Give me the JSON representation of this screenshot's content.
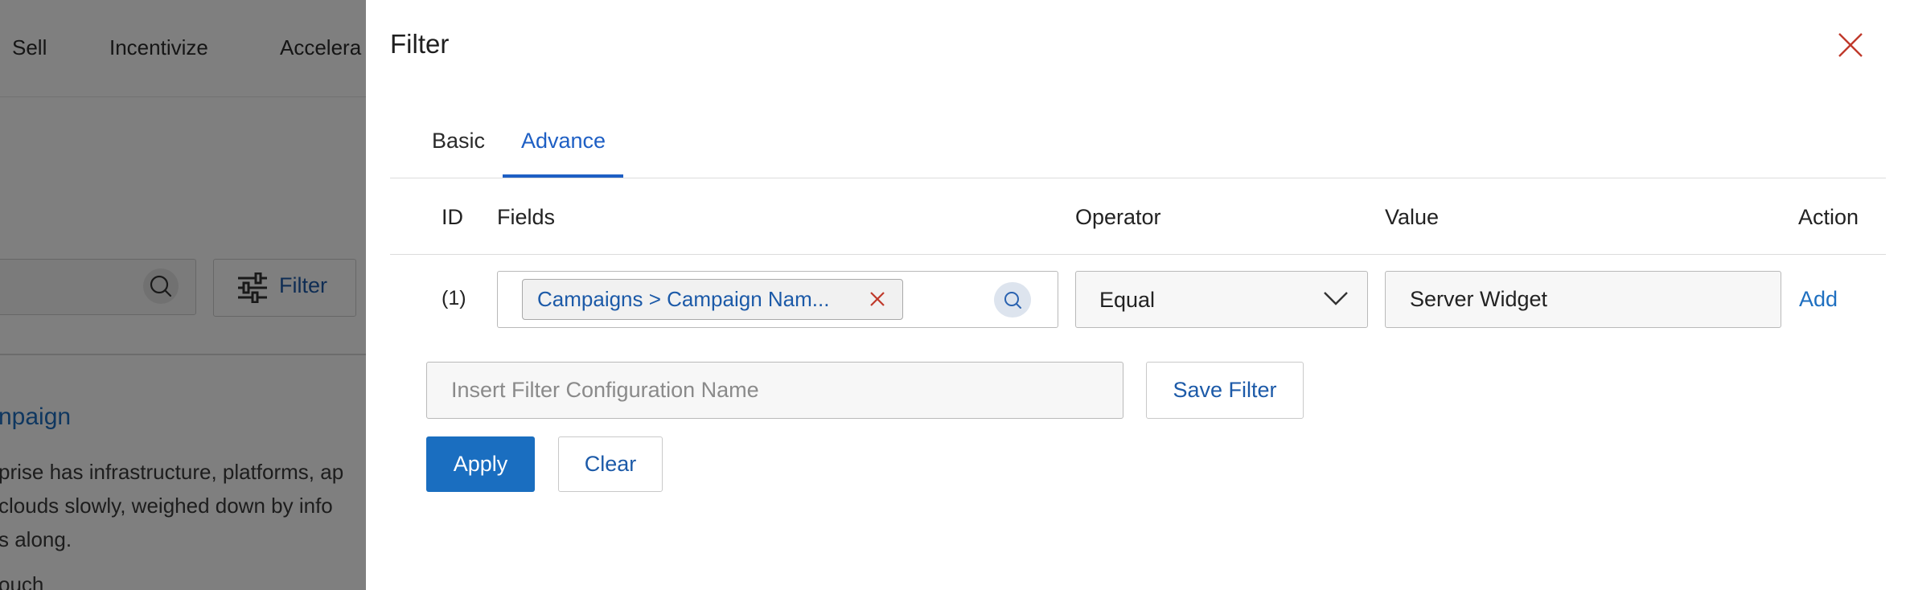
{
  "background": {
    "nav": {
      "items": [
        "Sell",
        "Incentivize",
        "Accelera"
      ]
    },
    "filter_button_label": "Filter",
    "campaign_link": "npaign",
    "description_lines": [
      "prise has infrastructure, platforms, ap",
      "clouds slowly, weighed down by info",
      "s along.",
      "ouch"
    ]
  },
  "drawer": {
    "title": "Filter",
    "tabs": [
      {
        "label": "Basic",
        "active": false
      },
      {
        "label": "Advance",
        "active": true
      }
    ],
    "columns": [
      "ID",
      "Fields",
      "Operator",
      "Value",
      "Action"
    ],
    "rows": [
      {
        "id": "(1)",
        "field_chip": "Campaigns > Campaign Nam...",
        "operator": "Equal",
        "value": "Server Widget",
        "action": "Add"
      }
    ],
    "config_name_placeholder": "Insert Filter Configuration Name",
    "save_filter_label": "Save Filter",
    "apply_label": "Apply",
    "clear_label": "Clear"
  },
  "colors": {
    "accent": "#1a6ec0",
    "link": "#1c5aa8",
    "overlay": "rgba(0,0,0,0.5)",
    "close_icon": "#c0392b"
  },
  "icons": {
    "close": "close-icon",
    "search": "search-icon",
    "chip_remove": "remove-icon",
    "dropdown": "chevron-down-icon",
    "filter": "sliders-icon"
  }
}
